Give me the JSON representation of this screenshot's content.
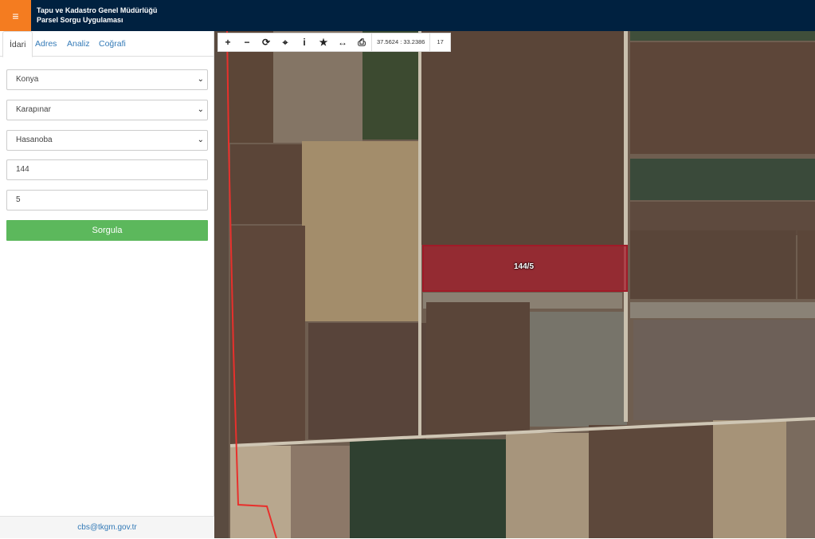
{
  "header": {
    "menu_icon": "≡",
    "title_line1": "Tapu ve Kadastro Genel Müdürlüğü",
    "title_line2": "Parsel Sorgu Uygulaması"
  },
  "tabs": [
    {
      "label": "İdari",
      "active": true
    },
    {
      "label": "Adres",
      "active": false
    },
    {
      "label": "Analiz",
      "active": false
    },
    {
      "label": "Coğrafi",
      "active": false
    }
  ],
  "form": {
    "province": "Konya",
    "district": "Karapınar",
    "neighborhood": "Hasanoba",
    "block": "144",
    "parcel": "5",
    "submit_label": "Sorgula"
  },
  "footer": {
    "email": "cbs@tkgm.gov.tr"
  },
  "toolbar": {
    "zoom_in": "+",
    "zoom_out": "−",
    "refresh": "⟳",
    "locate": "⌖",
    "info": "i",
    "favorite": "★",
    "measure": "↔",
    "print": "⎙",
    "coordinates": "37.5624 : 33.2386",
    "zoom_level": "17"
  },
  "map": {
    "parcel_label": "144/5",
    "parcel_color": "#a01b28",
    "boundary_color": "#e8302c"
  },
  "colors": {
    "header_bg": "#002140",
    "accent": "#f47c20",
    "button": "#5cb85c",
    "link": "#337ab7"
  }
}
